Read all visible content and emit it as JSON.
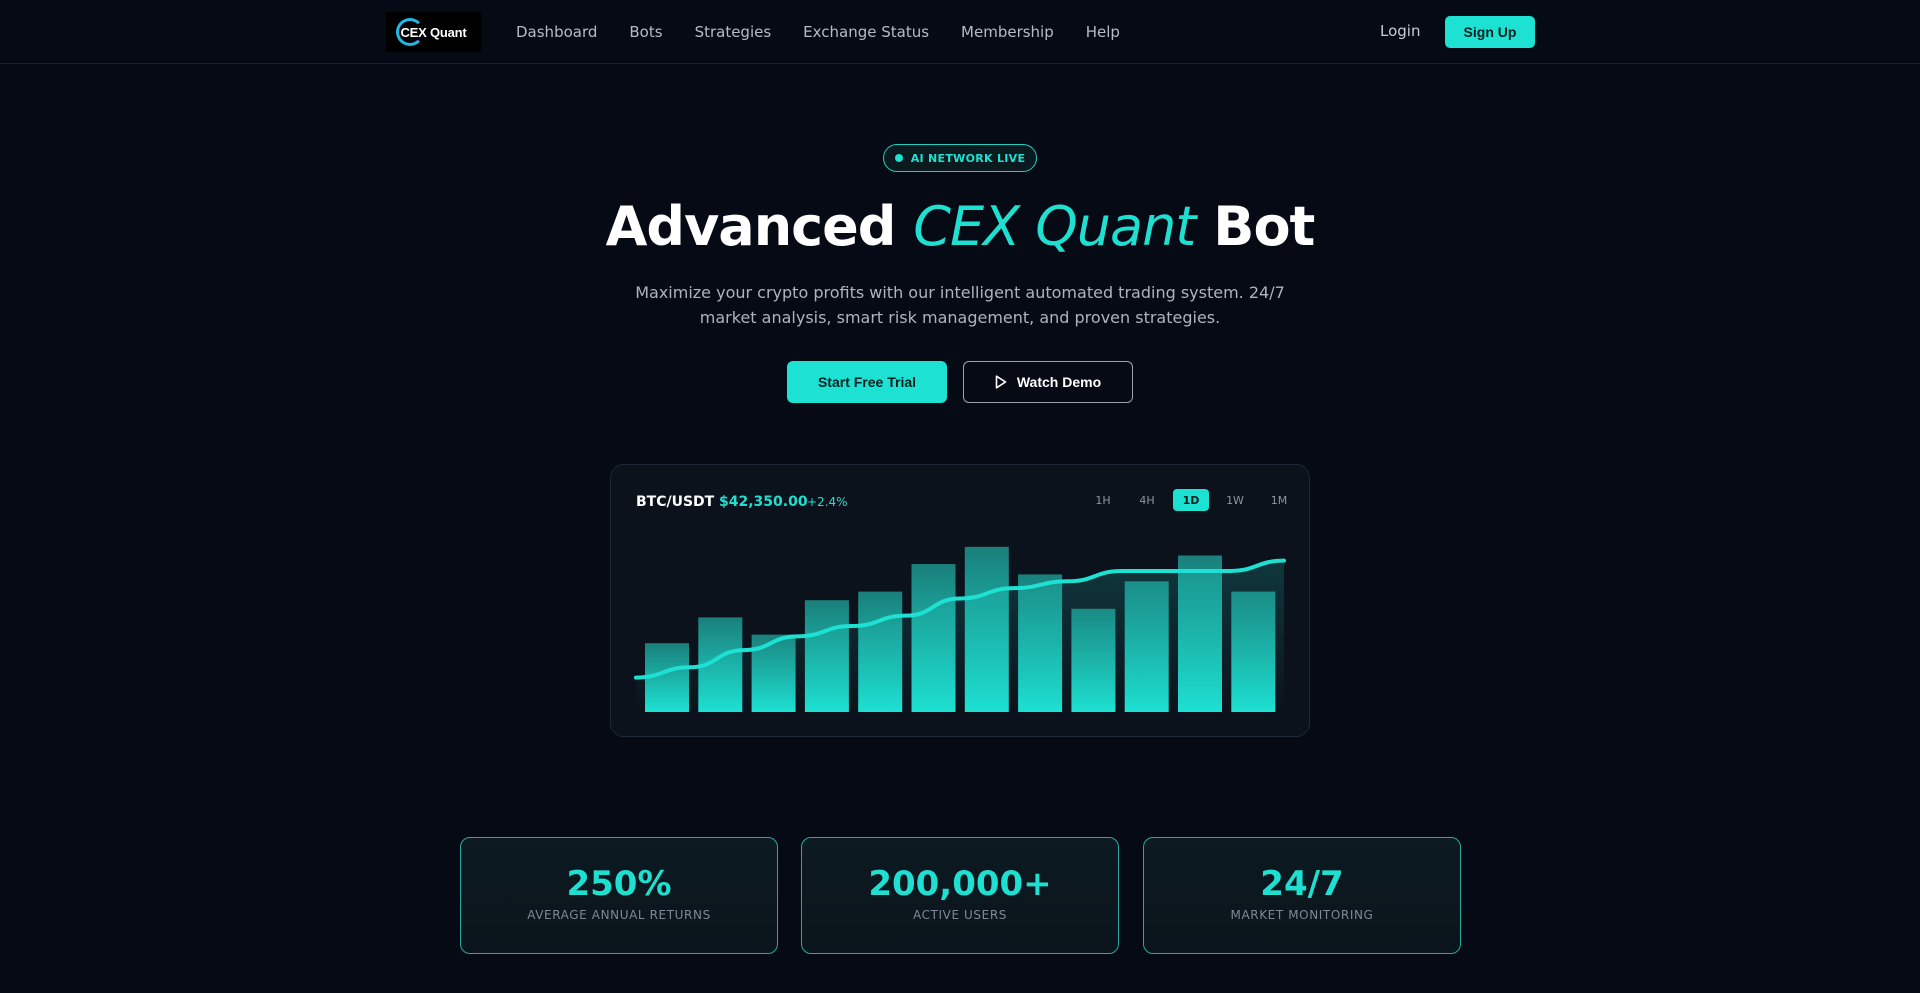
{
  "nav": {
    "logo_text": "CEX Quant",
    "links": [
      "Dashboard",
      "Bots",
      "Strategies",
      "Exchange Status",
      "Membership",
      "Help"
    ],
    "login": "Login",
    "signup": "Sign Up"
  },
  "hero": {
    "badge": "AI NETWORK LIVE",
    "title_prefix": "Advanced",
    "title_accent": "CEX Quant",
    "title_suffix": "Bot",
    "subtitle": "Maximize your crypto profits with our intelligent automated trading system. 24/7 market analysis, smart risk management, and proven strategies.",
    "primary_button": "Start Free Trial",
    "secondary_button": "Watch Demo"
  },
  "chart_panel": {
    "pair": "BTC/USDT",
    "price": "$42,350.00",
    "change": "+2.4%",
    "timeframes": [
      "1H",
      "4H",
      "1D",
      "1W",
      "1M"
    ],
    "active_timeframe": "1D"
  },
  "chart_data": {
    "type": "bar",
    "categories": [
      "",
      "",
      "",
      "",
      "",
      "",
      "",
      "",
      "",
      "",
      "",
      ""
    ],
    "values": [
      40,
      55,
      45,
      65,
      70,
      86,
      96,
      80,
      60,
      76,
      91,
      70
    ],
    "line": [
      20,
      26,
      36,
      44,
      50,
      56,
      66,
      72,
      76,
      82,
      82,
      82,
      88
    ],
    "ylim": [
      0,
      100
    ],
    "grid": false,
    "bar_color": "#1de1d2",
    "line_color": "#1de1d2"
  },
  "stats": [
    {
      "value": "250%",
      "label": "AVERAGE ANNUAL RETURNS"
    },
    {
      "value": "200,000+",
      "label": "ACTIVE USERS"
    },
    {
      "value": "24/7",
      "label": "MARKET MONITORING"
    }
  ],
  "colors": {
    "background": "#060a14",
    "accent": "#1de1d2"
  }
}
